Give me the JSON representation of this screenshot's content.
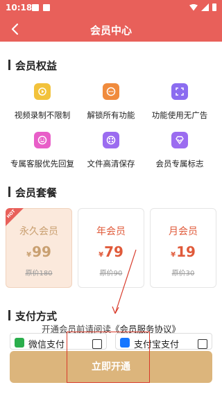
{
  "status_bar": {
    "time": "10:18"
  },
  "header": {
    "title": "会员中心"
  },
  "benefits": {
    "title": "会员权益",
    "items": [
      {
        "label": "视频录制不限制",
        "icon": "video-record-icon",
        "color": "#f2c23b"
      },
      {
        "label": "解锁所有功能",
        "icon": "unlock-icon",
        "color": "#f08b3d"
      },
      {
        "label": "功能使用无广告",
        "icon": "no-ads-icon",
        "color": "#8b6cf0"
      },
      {
        "label": "专属客服优先回复",
        "icon": "customer-service-icon",
        "color": "#e85ec8"
      },
      {
        "label": "文件高清保存",
        "icon": "hd-save-icon",
        "color": "#9b6cf0"
      },
      {
        "label": "会员专属标志",
        "icon": "vip-badge-icon",
        "color": "#9b6cf0"
      }
    ]
  },
  "plans": {
    "title": "会员套餐",
    "items": [
      {
        "name": "永久会员",
        "currency": "¥",
        "price": "99",
        "original": "原价180",
        "selected": true,
        "badge": "HOT"
      },
      {
        "name": "年会员",
        "currency": "¥",
        "price": "79",
        "original": "原价90",
        "selected": false
      },
      {
        "name": "月会员",
        "currency": "¥",
        "price": "19",
        "original": "原价30",
        "selected": false
      }
    ]
  },
  "payment": {
    "title": "支付方式",
    "methods": [
      {
        "label": "微信支付",
        "icon": "wechat-pay-icon",
        "color": "#2aae4c"
      },
      {
        "label": "支付宝支付",
        "icon": "alipay-icon",
        "color": "#1677ff"
      }
    ]
  },
  "agreement": {
    "prefix": "开通会员前请阅读",
    "link": "《会员服务协议》"
  },
  "cta": {
    "label": "立即开通"
  },
  "colors": {
    "primary": "#e8605a",
    "gold": "#dcb57c",
    "price_red": "#e05a3a"
  }
}
